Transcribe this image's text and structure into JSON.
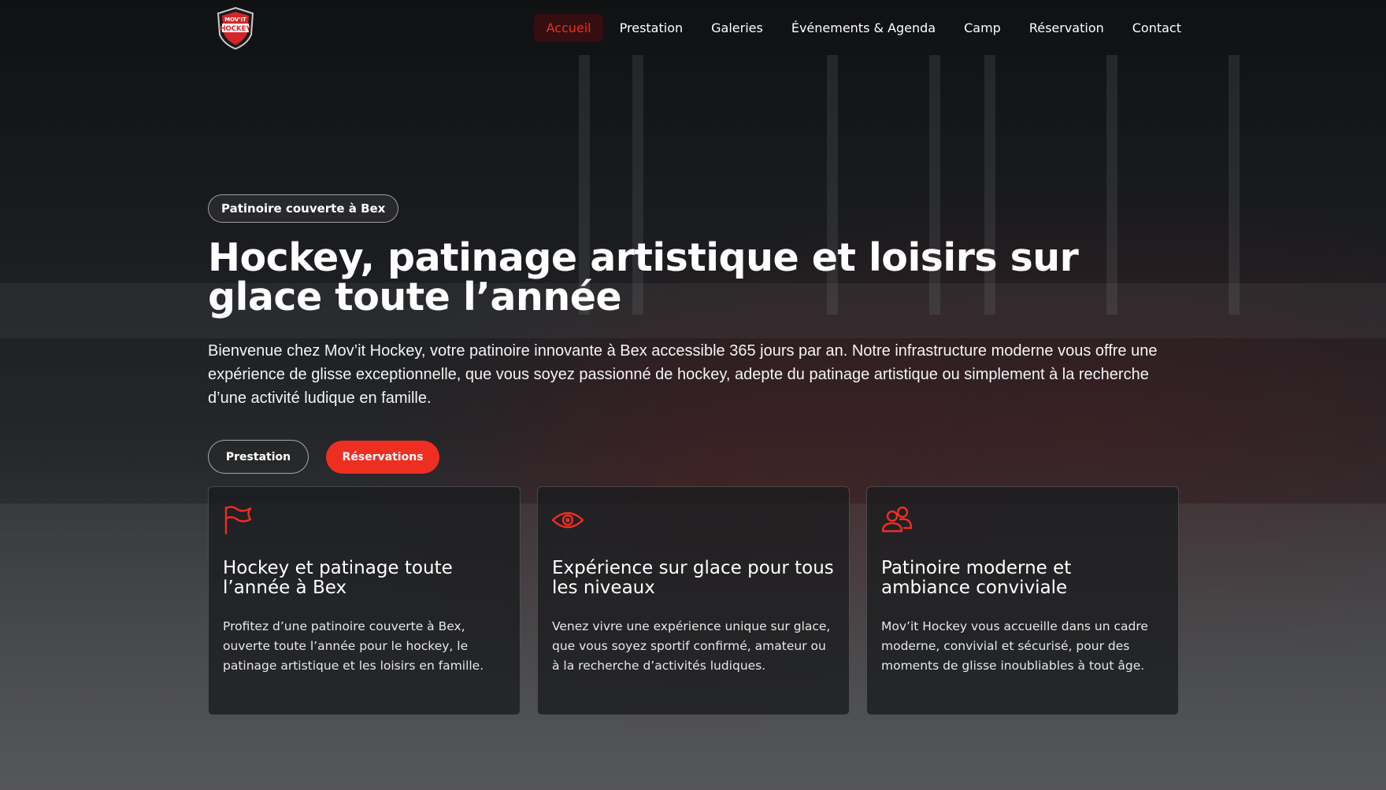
{
  "brand": {
    "logo_text_top": "MOV'IT",
    "logo_text_main": "HOCKEY",
    "accent_color": "#ef2e22"
  },
  "nav": {
    "items": [
      {
        "label": "Accueil",
        "active": true
      },
      {
        "label": "Prestation",
        "active": false
      },
      {
        "label": "Galeries",
        "active": false
      },
      {
        "label": "Événements & Agenda",
        "active": false
      },
      {
        "label": "Camp",
        "active": false
      },
      {
        "label": "Réservation",
        "active": false
      },
      {
        "label": "Contact",
        "active": false
      }
    ]
  },
  "hero": {
    "badge": "Patinoire couverte à Bex",
    "title": "Hockey, patinage artistique et loisirs sur glace toute l’année",
    "text": "Bienvenue chez Mov’it Hockey, votre patinoire innovante à Bex accessible 365 jours par an. Notre infrastructure moderne vous offre une expérience de glisse exceptionnelle, que vous soyez passionné de hockey, adepte du patinage artistique ou simplement à la recherche d’une activité ludique en famille.",
    "buttons": {
      "secondary": "Prestation",
      "primary": "Réservations"
    }
  },
  "cards": [
    {
      "icon": "flag-icon",
      "title": "Hockey et patinage toute l’année à Bex",
      "text": "Profitez d’une patinoire couverte à Bex, ouverte toute l’année pour le hockey, le patinage artistique et les loisirs en famille."
    },
    {
      "icon": "eye-icon",
      "title": "Expérience sur glace pour tous les niveaux",
      "text": "Venez vivre une expérience unique sur glace, que vous soyez sportif confirmé, amateur ou à la recherche d’activités ludiques."
    },
    {
      "icon": "users-icon",
      "title": "Patinoire moderne et ambiance conviviale",
      "text": "Mov’it Hockey vous accueille dans un cadre moderne, convivial et sécurisé, pour des moments de glisse inoubliables à tout âge."
    }
  ]
}
